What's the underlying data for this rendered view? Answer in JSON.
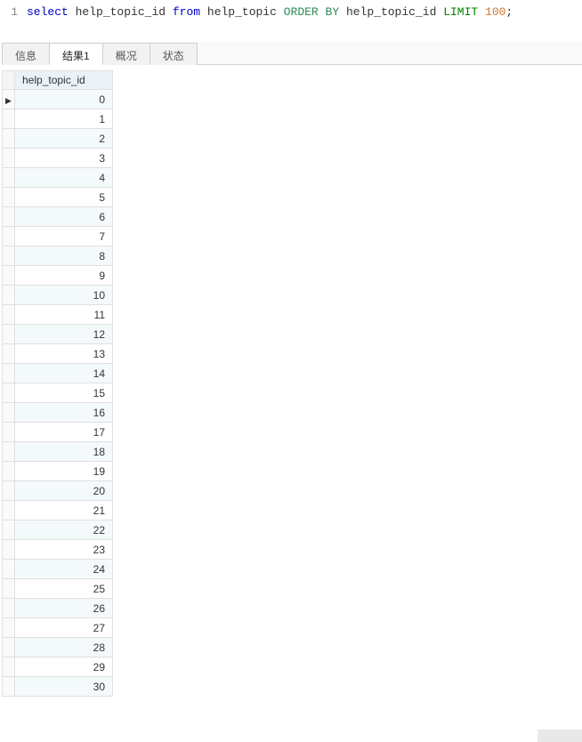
{
  "editor": {
    "line_number": "1",
    "tokens": [
      {
        "text": "select",
        "cls": "kw-blue"
      },
      {
        "text": " ",
        "cls": ""
      },
      {
        "text": "help_topic_id",
        "cls": "ident"
      },
      {
        "text": " ",
        "cls": ""
      },
      {
        "text": "from",
        "cls": "kw-blue"
      },
      {
        "text": " ",
        "cls": ""
      },
      {
        "text": "help_topic",
        "cls": "ident"
      },
      {
        "text": " ",
        "cls": ""
      },
      {
        "text": "ORDER BY",
        "cls": "kw-green-dark"
      },
      {
        "text": " ",
        "cls": ""
      },
      {
        "text": "help_topic_id",
        "cls": "ident"
      },
      {
        "text": " ",
        "cls": ""
      },
      {
        "text": "LIMIT",
        "cls": "kw-green"
      },
      {
        "text": " ",
        "cls": ""
      },
      {
        "text": "100",
        "cls": "num"
      },
      {
        "text": ";",
        "cls": "ident"
      }
    ]
  },
  "tabs": [
    {
      "label": "信息",
      "active": false
    },
    {
      "label": "结果1",
      "active": true
    },
    {
      "label": "概况",
      "active": false
    },
    {
      "label": "状态",
      "active": false
    }
  ],
  "result": {
    "column_header": "help_topic_id",
    "rows": [
      {
        "value": "0",
        "current": true
      },
      {
        "value": "1",
        "current": false
      },
      {
        "value": "2",
        "current": false
      },
      {
        "value": "3",
        "current": false
      },
      {
        "value": "4",
        "current": false
      },
      {
        "value": "5",
        "current": false
      },
      {
        "value": "6",
        "current": false
      },
      {
        "value": "7",
        "current": false
      },
      {
        "value": "8",
        "current": false
      },
      {
        "value": "9",
        "current": false
      },
      {
        "value": "10",
        "current": false
      },
      {
        "value": "11",
        "current": false
      },
      {
        "value": "12",
        "current": false
      },
      {
        "value": "13",
        "current": false
      },
      {
        "value": "14",
        "current": false
      },
      {
        "value": "15",
        "current": false
      },
      {
        "value": "16",
        "current": false
      },
      {
        "value": "17",
        "current": false
      },
      {
        "value": "18",
        "current": false
      },
      {
        "value": "19",
        "current": false
      },
      {
        "value": "20",
        "current": false
      },
      {
        "value": "21",
        "current": false
      },
      {
        "value": "22",
        "current": false
      },
      {
        "value": "23",
        "current": false
      },
      {
        "value": "24",
        "current": false
      },
      {
        "value": "25",
        "current": false
      },
      {
        "value": "26",
        "current": false
      },
      {
        "value": "27",
        "current": false
      },
      {
        "value": "28",
        "current": false
      },
      {
        "value": "29",
        "current": false
      },
      {
        "value": "30",
        "current": false
      }
    ]
  }
}
